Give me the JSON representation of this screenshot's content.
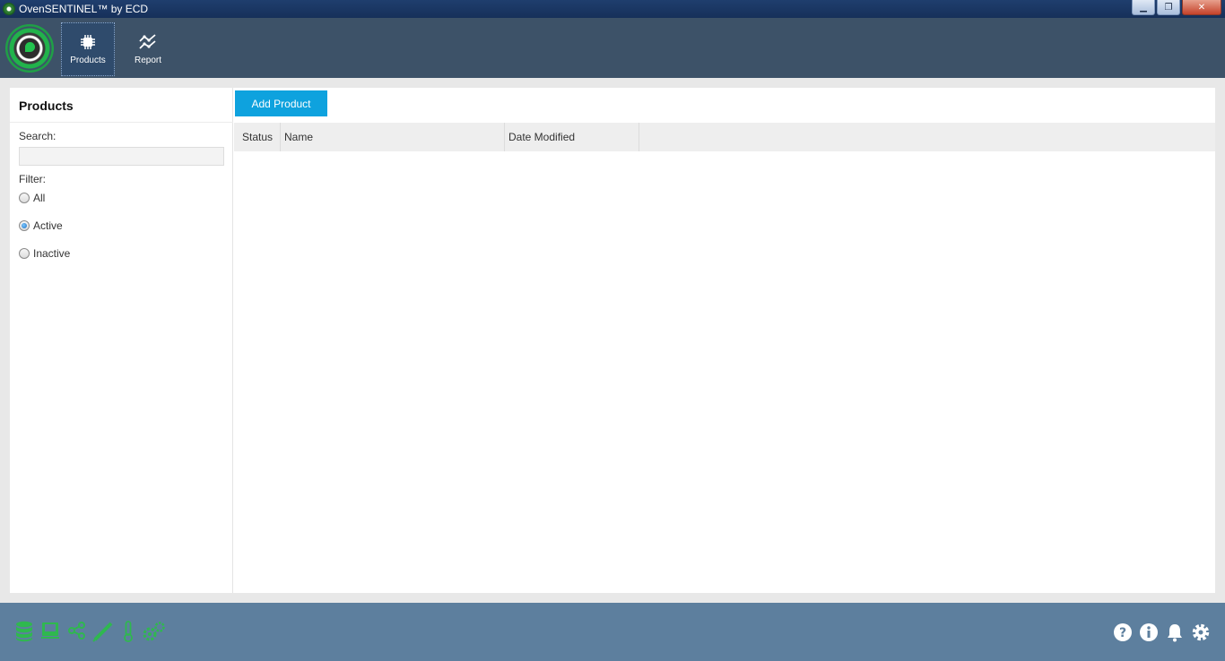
{
  "window": {
    "title": "OvenSENTINEL™ by ECD"
  },
  "colors": {
    "toolbar": "#3d5268",
    "accent": "#0ea2de",
    "footer": "#5d7f9e",
    "footer_icons": "#2fb84f",
    "logo_green": "#21b34b"
  },
  "toolbar": {
    "items": [
      {
        "label": "Products",
        "icon": "chip-icon",
        "active": true
      },
      {
        "label": "Report",
        "icon": "chart-line-icon",
        "active": false
      }
    ]
  },
  "sidebar": {
    "title": "Products",
    "search_label": "Search:",
    "search_value": "",
    "filter_label": "Filter:",
    "filters": [
      {
        "label": "All",
        "checked": false
      },
      {
        "label": "Active",
        "checked": true
      },
      {
        "label": "Inactive",
        "checked": false
      }
    ]
  },
  "content": {
    "add_button": "Add Product",
    "columns": [
      "Status",
      "Name",
      "Date Modified"
    ],
    "rows": []
  },
  "footer": {
    "left_icons": [
      "database-icon",
      "board-icon",
      "share-icon",
      "probe-icon",
      "thermometer-icon",
      "gears-icon"
    ],
    "right_icons": [
      "help-icon",
      "info-icon",
      "bell-icon",
      "gear-icon"
    ]
  }
}
